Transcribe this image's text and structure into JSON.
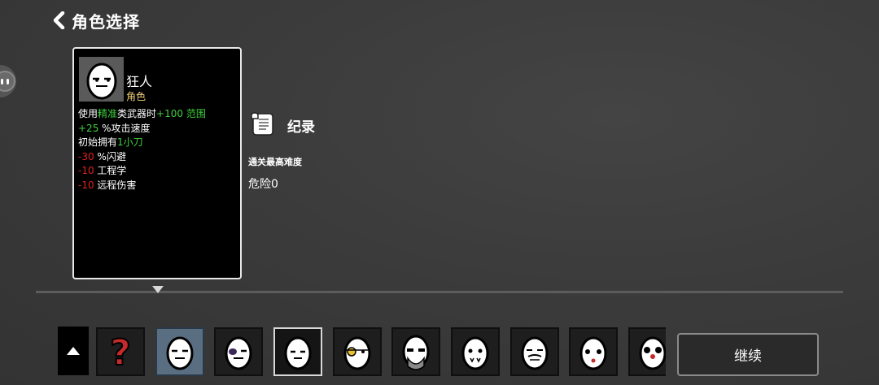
{
  "header": {
    "title": "角色选择"
  },
  "character": {
    "name": "狂人",
    "type": "角色",
    "stats": [
      {
        "parts": [
          {
            "t": "使用",
            "c": "w"
          },
          {
            "t": "精准",
            "c": "g"
          },
          {
            "t": "类武器时",
            "c": "w"
          },
          {
            "t": "+100 范围",
            "c": "g"
          }
        ]
      },
      {
        "parts": [
          {
            "t": "+25",
            "c": "g"
          },
          {
            "t": " %攻击速度",
            "c": "w"
          }
        ]
      },
      {
        "parts": [
          {
            "t": "初始拥有",
            "c": "w"
          },
          {
            "t": "1小刀",
            "c": "g"
          }
        ]
      },
      {
        "parts": [
          {
            "t": "-30",
            "c": "r"
          },
          {
            "t": " %闪避",
            "c": "w"
          }
        ]
      },
      {
        "parts": [
          {
            "t": "-10",
            "c": "r"
          },
          {
            "t": " 工程学",
            "c": "w"
          }
        ]
      },
      {
        "parts": [
          {
            "t": "-10",
            "c": "r"
          },
          {
            "t": " 远程伤害",
            "c": "w"
          }
        ]
      }
    ]
  },
  "records": {
    "title": "纪录",
    "best_difficulty_label": "通关最高难度",
    "best_difficulty_value": "危险0"
  },
  "selector": {
    "slots": [
      "random",
      "madman",
      "bandit",
      "blank",
      "pirate",
      "viking",
      "vampire",
      "sage",
      "hurt",
      "clown"
    ],
    "selected_index": 1,
    "hover_index": 3
  },
  "actions": {
    "continue_label": "继续"
  },
  "colors": {
    "positive": "#3fd03f",
    "negative": "#e02020",
    "type_label": "#f2d07a",
    "selected_slot": "#5a6e82"
  }
}
